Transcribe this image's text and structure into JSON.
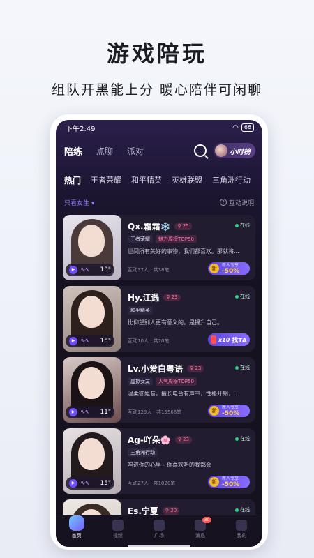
{
  "promo": {
    "title": "游戏陪玩",
    "subtitle": "组队开黑能上分 暖心陪伴可闲聊"
  },
  "status_bar": {
    "time": "下午2:49",
    "battery": "66"
  },
  "top_tabs": [
    {
      "label": "陪练",
      "active": true
    },
    {
      "label": "点聊",
      "active": false
    },
    {
      "label": "派对",
      "active": false
    }
  ],
  "rank_button": {
    "label": "小时榜"
  },
  "categories": [
    "热门",
    "王者荣耀",
    "和平精英",
    "英雄联盟",
    "三角洲行动"
  ],
  "filter": {
    "dropdown": "只看女生",
    "help": "互动说明"
  },
  "cards": [
    {
      "name": "Qx.霜霜❄️",
      "age": "25",
      "online": "在线",
      "tags": [
        "王者荣耀",
        "魅力周榜TOP50"
      ],
      "bio": "世间所有美好的事物，我们都喜欢。那就将...",
      "stats": "互动37人 · 共38笔",
      "duration": "13\"",
      "promo_line1": "新人专享",
      "promo_line2": "-50%",
      "coin": "新"
    },
    {
      "name": "Hy.江遇",
      "age": "23",
      "online": "在线",
      "tags": [
        "和平精英"
      ],
      "bio": "比仰望别人更有意义的，是提升自己。",
      "stats": "互动10人 · 共20笔",
      "duration": "15\"",
      "find_count": "x10",
      "find_label": "找TA"
    },
    {
      "name": "Lv.小爱白粤语",
      "age": "23",
      "online": "在线",
      "tags": [
        "虚拟女友",
        "人气周榜TOP50"
      ],
      "bio": "温柔御姐音，擅长电台有声书，性格开朗，...",
      "stats": "互动123人 · 共15566笔",
      "duration": "11\"",
      "promo_line1": "新人专享",
      "promo_line2": "-50%",
      "coin": "新"
    },
    {
      "name": "Ag-吖朵🌸",
      "age": "23",
      "online": "在线",
      "tags": [
        "三角洲行动"
      ],
      "bio": "唱进你的心里 - 你喜欢听的我都会",
      "stats": "互动27人 · 共1020笔",
      "duration": "15\"",
      "promo_line1": "新人专享",
      "promo_line2": "-50%",
      "coin": "新"
    },
    {
      "name": "Es.宁夏",
      "age": "20",
      "online": "在线"
    }
  ],
  "bottom_nav": [
    {
      "label": "首页",
      "active": true
    },
    {
      "label": "视频",
      "active": false
    },
    {
      "label": "广场",
      "active": false
    },
    {
      "label": "消息",
      "active": false,
      "badge": "30"
    },
    {
      "label": "我的",
      "active": false
    }
  ],
  "colors": {
    "accent": "#7a5cff",
    "online": "#2fd08a",
    "background": "#15111f"
  }
}
